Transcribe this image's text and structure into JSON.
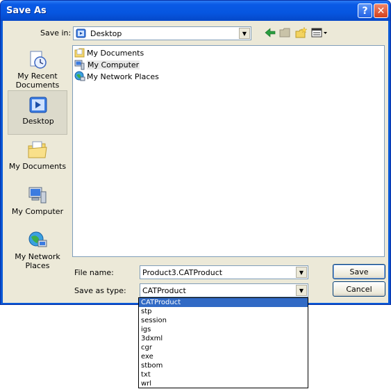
{
  "window": {
    "title": "Save As"
  },
  "titlebar": {
    "help": "?",
    "close": "✕"
  },
  "save_in": {
    "label": "Save in:",
    "value": "Desktop"
  },
  "places": [
    {
      "label": "My Recent Documents",
      "icon": "recent-documents-icon"
    },
    {
      "label": "Desktop",
      "icon": "desktop-icon",
      "active": true
    },
    {
      "label": "My Documents",
      "icon": "my-documents-icon"
    },
    {
      "label": "My Computer",
      "icon": "my-computer-icon"
    },
    {
      "label": "My Network Places",
      "icon": "network-places-icon"
    }
  ],
  "files": [
    {
      "name": "My Documents",
      "icon": "folder-documents-icon"
    },
    {
      "name": "My Computer",
      "icon": "computer-icon"
    },
    {
      "name": "My Network Places",
      "icon": "network-icon"
    }
  ],
  "file_name": {
    "label": "File name:",
    "value": "Product3.CATProduct"
  },
  "save_as_type": {
    "label": "Save as type:",
    "value": "CATProduct"
  },
  "buttons": {
    "save": "Save",
    "cancel": "Cancel"
  },
  "type_options": [
    "CATProduct",
    "stp",
    "session",
    "igs",
    "3dxml",
    "cgr",
    "exe",
    "stbom",
    "txt",
    "wrl"
  ],
  "selected_type_index": 0,
  "colors": {
    "titlebar": "#0a5ae6",
    "selection": "#316ac5",
    "dialog_bg": "#ece9d8"
  }
}
